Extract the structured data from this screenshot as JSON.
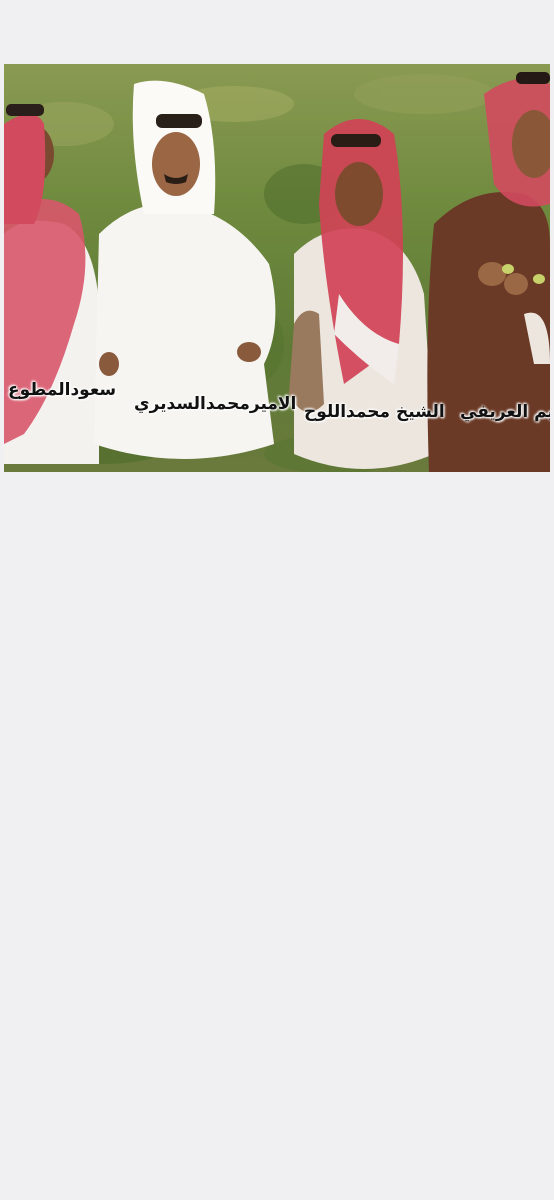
{
  "photo": {
    "captions": [
      {
        "text": "سعودالمطوع"
      },
      {
        "text": "الاميرمحمدالسديري"
      },
      {
        "text": "الشيخ محمداللوح"
      },
      {
        "text": "ابراهيم العريفي"
      }
    ]
  },
  "colors": {
    "background": "#f0f0f2",
    "grass": "#6f8a3e",
    "thobe_white": "#f4f2ee",
    "shemagh_red": "#c8384a",
    "brown_cloak": "#6b3a26"
  }
}
